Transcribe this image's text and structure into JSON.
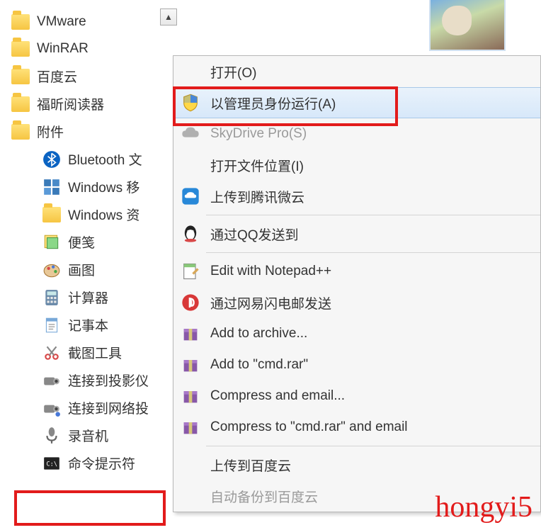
{
  "watermark": "hongyi5",
  "start_menu": {
    "items": [
      {
        "label": "VMware",
        "icon": "folder-open"
      },
      {
        "label": "WinRAR",
        "icon": "folder"
      },
      {
        "label": "百度云",
        "icon": "folder"
      },
      {
        "label": "福昕阅读器",
        "icon": "folder"
      },
      {
        "label": "附件",
        "icon": "folder-open"
      }
    ],
    "sub_items": [
      {
        "label": "Bluetooth 文",
        "icon": "bluetooth"
      },
      {
        "label": "Windows 移",
        "icon": "mobility"
      },
      {
        "label": "Windows 资",
        "icon": "explorer"
      },
      {
        "label": "便笺",
        "icon": "sticky"
      },
      {
        "label": "画图",
        "icon": "paint"
      },
      {
        "label": "计算器",
        "icon": "calc"
      },
      {
        "label": "记事本",
        "icon": "notepad"
      },
      {
        "label": "截图工具",
        "icon": "snip"
      },
      {
        "label": "连接到投影仪",
        "icon": "projector"
      },
      {
        "label": "连接到网络投",
        "icon": "netproj"
      },
      {
        "label": "录音机",
        "icon": "recorder"
      },
      {
        "label": "命令提示符",
        "icon": "cmd"
      }
    ]
  },
  "context_menu": {
    "items": [
      {
        "label": "打开(O)",
        "icon": null
      },
      {
        "label": "以管理员身份运行(A)",
        "icon": "shield",
        "hover": true
      },
      {
        "label": "SkyDrive Pro(S)",
        "icon": "cloud",
        "disabled": true
      },
      {
        "label": "打开文件位置(I)",
        "icon": null
      },
      {
        "label": "上传到腾讯微云",
        "icon": "weiyun"
      },
      {
        "sep": true
      },
      {
        "label": "通过QQ发送到",
        "icon": "qq"
      },
      {
        "sep": true
      },
      {
        "label": "Edit with Notepad++",
        "icon": "npp"
      },
      {
        "label": "通过网易闪电邮发送",
        "icon": "netease"
      },
      {
        "label": "Add to archive...",
        "icon": "winrar"
      },
      {
        "label": "Add to \"cmd.rar\"",
        "icon": "winrar"
      },
      {
        "label": "Compress and email...",
        "icon": "winrar"
      },
      {
        "label": "Compress to \"cmd.rar\" and email",
        "icon": "winrar"
      },
      {
        "sep": true
      },
      {
        "label": "上传到百度云",
        "icon": null
      },
      {
        "label": "自动备份到百度云",
        "icon": null,
        "disabled": true
      }
    ]
  }
}
